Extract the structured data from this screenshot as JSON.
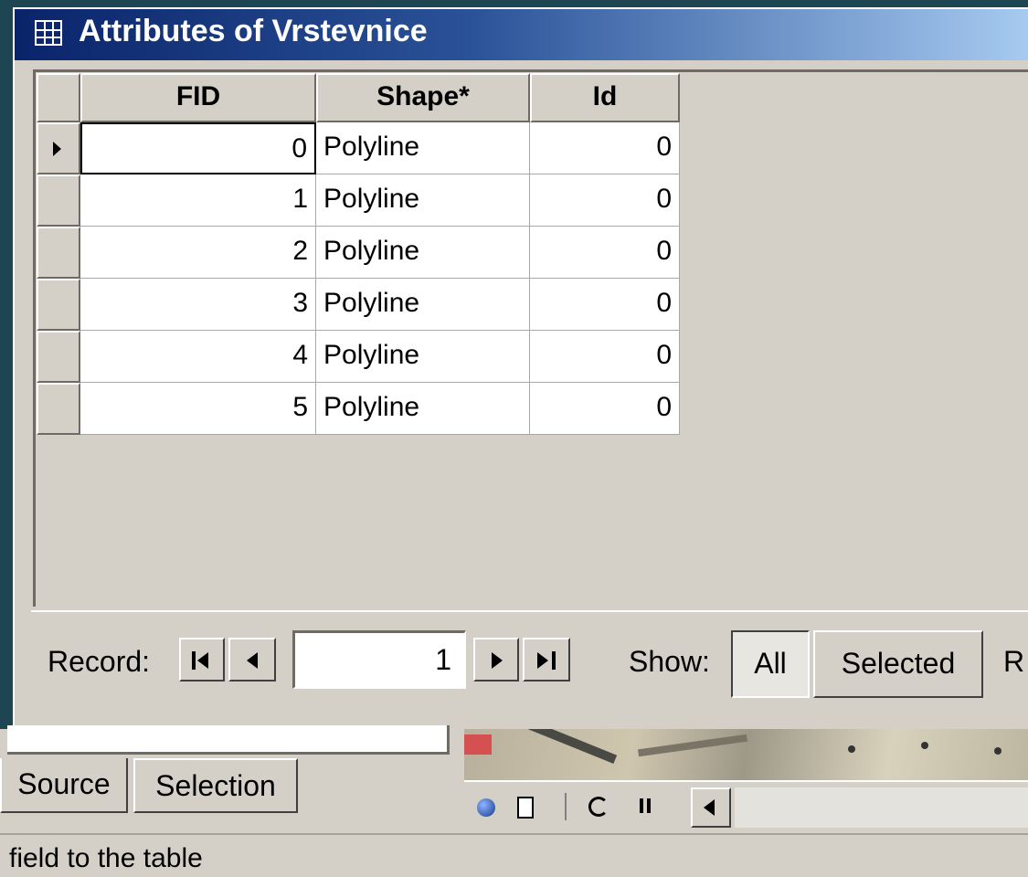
{
  "window": {
    "title": "Attributes of Vrstevnice"
  },
  "table": {
    "columns": [
      "FID",
      "Shape*",
      "Id"
    ],
    "rows": [
      {
        "fid": "0",
        "shape": "Polyline",
        "id": "0"
      },
      {
        "fid": "1",
        "shape": "Polyline",
        "id": "0"
      },
      {
        "fid": "2",
        "shape": "Polyline",
        "id": "0"
      },
      {
        "fid": "3",
        "shape": "Polyline",
        "id": "0"
      },
      {
        "fid": "4",
        "shape": "Polyline",
        "id": "0"
      },
      {
        "fid": "5",
        "shape": "Polyline",
        "id": "0"
      }
    ],
    "current_row": 0
  },
  "nav": {
    "record_label": "Record:",
    "record_value": "1",
    "show_label": "Show:",
    "all_label": "All",
    "selected_label": "Selected",
    "truncated_label": "R"
  },
  "toc_tabs": {
    "source": "Source",
    "selection": "Selection"
  },
  "status": {
    "text": "field to the table"
  },
  "colors": {
    "title_gradient_start": "#0a246a",
    "title_gradient_end": "#a6caf0",
    "face": "#d4d0c8",
    "background": "#1e4652"
  }
}
